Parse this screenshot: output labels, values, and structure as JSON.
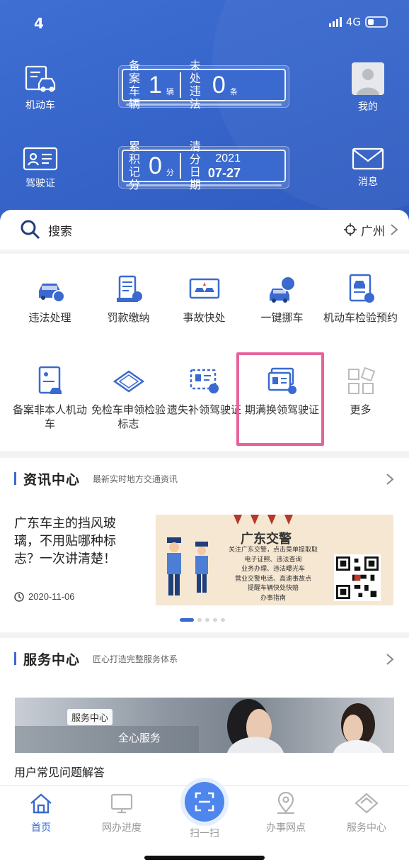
{
  "status_bar": {
    "time": "4",
    "network": "4G"
  },
  "header": {
    "left_buttons": [
      {
        "label": "机动车",
        "icon": "car-card-icon"
      },
      {
        "label": "驾驶证",
        "icon": "id-card-icon"
      }
    ],
    "right_buttons": [
      {
        "label": "我的",
        "icon": "avatar-icon"
      },
      {
        "label": "消息",
        "icon": "envelope-icon"
      }
    ],
    "plate1": {
      "label_a": "备案车辆",
      "value_a": "1",
      "unit_a": "辆",
      "label_b": "未处违法",
      "value_b": "0",
      "unit_b": "条"
    },
    "plate2": {
      "label_a": "累积记分",
      "value_a": "0",
      "unit_a": "分",
      "label_b": "清分日期",
      "year": "2021",
      "month_day": "07-27"
    }
  },
  "search": {
    "placeholder": "搜索",
    "city": "广州"
  },
  "services": [
    {
      "label": "违法处理",
      "icon": "violation-car-icon"
    },
    {
      "label": "罚款缴纳",
      "icon": "fine-payment-icon"
    },
    {
      "label": "事故快处",
      "icon": "accident-icon"
    },
    {
      "label": "一键挪车",
      "icon": "move-car-icon"
    },
    {
      "label": "机动车检验预约",
      "icon": "inspection-booking-icon"
    },
    {
      "label": "备案非本人机动车",
      "icon": "register-car-icon"
    },
    {
      "label": "免检车申领检验标志",
      "icon": "inspection-sign-icon"
    },
    {
      "label": "遗失补领驾驶证",
      "icon": "lost-license-icon"
    },
    {
      "label": "期满换领驾驶证",
      "icon": "renew-license-icon"
    },
    {
      "label": "更多",
      "icon": "more-grid-icon"
    }
  ],
  "news": {
    "title": "资讯中心",
    "subtitle": "最新实时地方交通资讯",
    "headline": "广东车主的挡风玻璃，不用贴哪种标志？一次讲清楚！",
    "date": "2020-11-06",
    "poster": {
      "title": "广东交警",
      "lines": [
        "关注广东交警，点击菜单提取取",
        "电子证照、违法查询",
        "业务办理、违法曝光车",
        "营业交警电话、高速事故点",
        "提醒车辆快处快赔",
        "办事指南"
      ]
    }
  },
  "service_center": {
    "title": "服务中心",
    "subtitle": "匠心打造完整服务体系",
    "banner_tag": "服务中心",
    "banner_text": "全心服务",
    "faq": "用户常见问题解答"
  },
  "tabbar": [
    {
      "label": "首页",
      "icon": "home-icon",
      "active": true
    },
    {
      "label": "网办进度",
      "icon": "monitor-icon",
      "active": false
    },
    {
      "label": "扫一扫",
      "icon": "scan-icon",
      "active": false
    },
    {
      "label": "办事网点",
      "icon": "location-pin-icon",
      "active": false
    },
    {
      "label": "服务中心",
      "icon": "service-diamond-icon",
      "active": false
    }
  ],
  "colors": {
    "primary": "#3a6ad0",
    "highlight": "#e8629a"
  }
}
